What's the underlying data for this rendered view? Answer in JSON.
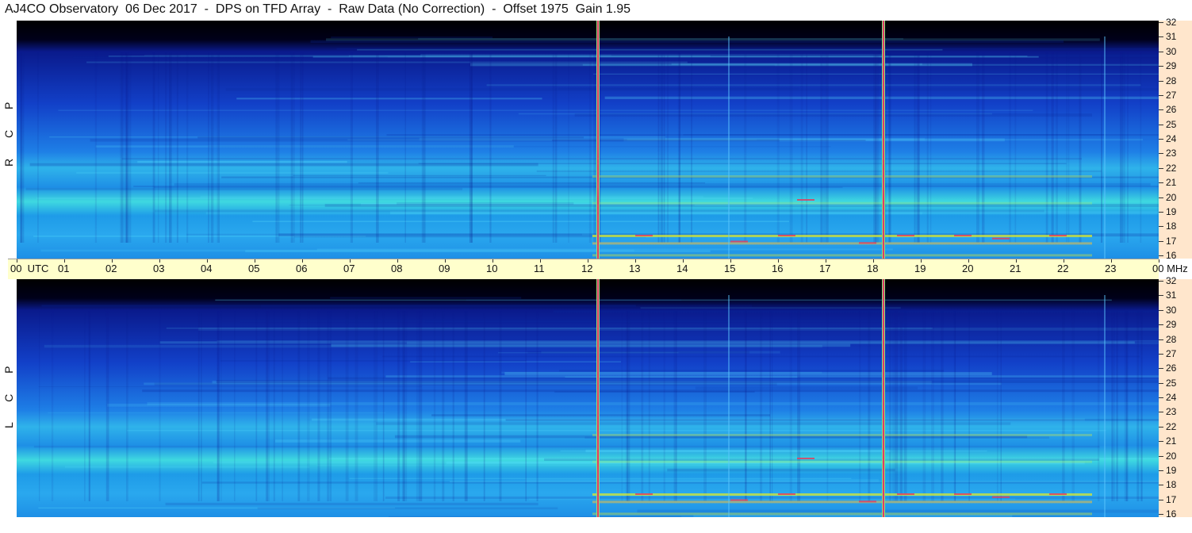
{
  "title": "AJ4CO Observatory  06 Dec 2017  -  DPS on TFD Array  -  Raw Data (No Correction)  -  Offset 1975  Gain 1.95",
  "panels": [
    {
      "label": "R C P"
    },
    {
      "label": "L C P"
    }
  ],
  "chart_data": {
    "type": "heatmap",
    "title": "AJ4CO Observatory  06 Dec 2017  -  DPS on TFD Array  -  Raw Data (No Correction)  -  Offset 1975  Gain 1.95",
    "x_unit": "UTC",
    "y_unit": "MHz",
    "x_ticks": [
      "00",
      "01",
      "02",
      "03",
      "04",
      "05",
      "06",
      "07",
      "08",
      "09",
      "10",
      "11",
      "12",
      "13",
      "14",
      "15",
      "16",
      "17",
      "18",
      "19",
      "20",
      "21",
      "22",
      "23",
      "00"
    ],
    "y_ticks": [
      "32",
      "31",
      "30",
      "29",
      "28",
      "27",
      "26",
      "25",
      "24",
      "23",
      "22",
      "21",
      "20",
      "19",
      "18",
      "17",
      "16"
    ],
    "xlim": [
      0,
      24
    ],
    "ylim": [
      16,
      32
    ],
    "series": [
      {
        "name": "R C P"
      },
      {
        "name": "L C P"
      }
    ],
    "markers_utc": [
      12.2,
      18.2
    ]
  },
  "colors": {
    "background": "#000000",
    "low": "#0a1a8c",
    "mid": "#1e7fe6",
    "high": "#3fd9e0",
    "peak": "#d8e830",
    "marker": "#e23a6a",
    "time_axis_bg": "#ffffcc",
    "freq_axis_bg": "#ffe6cc"
  }
}
